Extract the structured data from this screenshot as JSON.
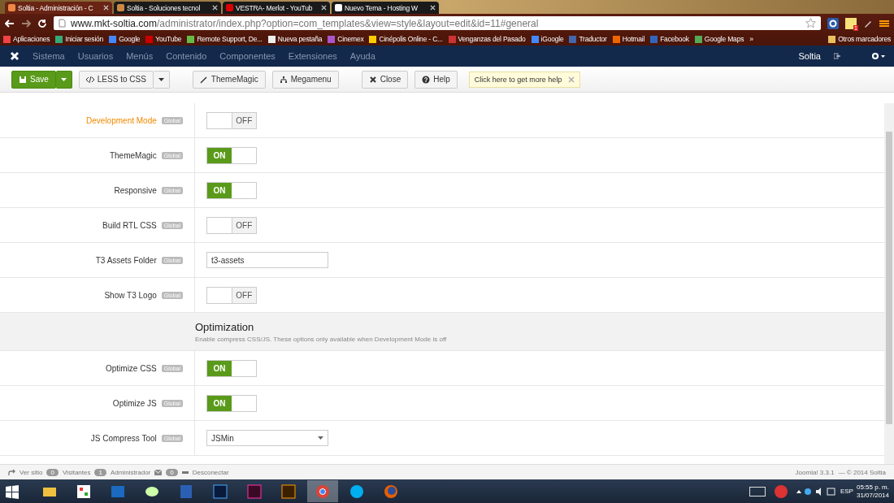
{
  "browser": {
    "tabs": [
      {
        "title": "Soltia - Administración - C",
        "selected": true
      },
      {
        "title": "Soltia - Soluciones tecnol",
        "selected": false
      },
      {
        "title": "VESTRA- Merlot - YouTub",
        "selected": false
      },
      {
        "title": "Nuevo Tema - Hosting W",
        "selected": false
      }
    ],
    "url_host": "www.mkt-soltia.com",
    "url_path": "/administrator/index.php?option=com_templates&view=style&layout=edit&id=11#general",
    "extension_badge": "1",
    "bookmarks": [
      "Aplicaciones",
      "Iniciar sesión",
      "Google",
      "YouTube",
      "Remote Support, De...",
      "Nueva pestaña",
      "Cinemex",
      "Cinépolis Online - C...",
      "Venganzas del Pasado",
      "iGoogle",
      "Traductor",
      "Hotmail",
      "Facebook",
      "Google Maps"
    ],
    "overflow": "»",
    "other_bookmarks": "Otros marcadores"
  },
  "admin_menu": {
    "items": [
      "Sistema",
      "Usuarios",
      "Menús",
      "Contenido",
      "Componentes",
      "Extensiones",
      "Ayuda"
    ],
    "user": "Soltia"
  },
  "toolbar": {
    "buttons": [
      {
        "label": "Save",
        "kind": "primary",
        "dropdown": true
      },
      {
        "label": "LESS to CSS",
        "kind": "default",
        "dropdown": true
      },
      {
        "label": "ThemeMagic",
        "kind": "default",
        "dropdown": false
      },
      {
        "label": "Megamenu",
        "kind": "default",
        "dropdown": false
      },
      {
        "label": "Close",
        "kind": "default",
        "dropdown": false
      },
      {
        "label": "Help",
        "kind": "default",
        "dropdown": false
      }
    ],
    "tip": "Click here to get more help"
  },
  "settings": [
    {
      "kind": "toggle",
      "label": "Development Mode",
      "highlighted": true,
      "badge": "Global",
      "on": false,
      "state_text": "OFF"
    },
    {
      "kind": "toggle",
      "label": "ThemeMagic",
      "highlighted": false,
      "badge": "Global",
      "on": true,
      "state_text": "ON"
    },
    {
      "kind": "toggle",
      "label": "Responsive",
      "highlighted": false,
      "badge": "Global",
      "on": true,
      "state_text": "ON"
    },
    {
      "kind": "toggle",
      "label": "Build RTL CSS",
      "highlighted": false,
      "badge": "Global",
      "on": false,
      "state_text": "OFF"
    },
    {
      "kind": "text",
      "label": "T3 Assets Folder",
      "highlighted": false,
      "badge": "Global",
      "value": "t3-assets"
    },
    {
      "kind": "toggle",
      "label": "Show T3 Logo",
      "highlighted": false,
      "badge": "Global",
      "on": false,
      "state_text": "OFF"
    },
    {
      "kind": "section",
      "title": "Optimization",
      "description": "Enable compress CSS/JS. These options only available when Development Mode is off"
    },
    {
      "kind": "toggle",
      "label": "Optimize CSS",
      "highlighted": false,
      "badge": "Global",
      "on": true,
      "state_text": "ON"
    },
    {
      "kind": "toggle",
      "label": "Optimize JS",
      "highlighted": false,
      "badge": "Global",
      "on": true,
      "state_text": "ON"
    },
    {
      "kind": "select",
      "label": "JS Compress Tool",
      "highlighted": false,
      "badge": "Global",
      "value": "JSMin"
    }
  ],
  "status_bar": {
    "view_site": "Ver sitio",
    "visitors_count": "0",
    "visitors": "Visitantes",
    "admins_count": "1",
    "admins": "Administrador",
    "messages_count": "0",
    "logout": "Desconectar",
    "version": "Joomla! 3.3.1",
    "copyright": "— © 2014 Soltia"
  },
  "taskbar": {
    "apps": [
      {
        "kind": "explorer",
        "selected": false
      },
      {
        "kind": "grid",
        "selected": false
      },
      {
        "kind": "outlook",
        "selected": false
      },
      {
        "kind": "paint",
        "selected": false
      },
      {
        "kind": "word",
        "selected": false
      },
      {
        "kind": "photoshop",
        "selected": false
      },
      {
        "kind": "indesign",
        "selected": false
      },
      {
        "kind": "illustrator",
        "selected": false
      },
      {
        "kind": "chrome",
        "selected": true
      },
      {
        "kind": "skype",
        "selected": false
      },
      {
        "kind": "firefox",
        "selected": false
      }
    ],
    "language": "ESP",
    "time": "05:55 p. m.",
    "date": "31/07/2014"
  }
}
